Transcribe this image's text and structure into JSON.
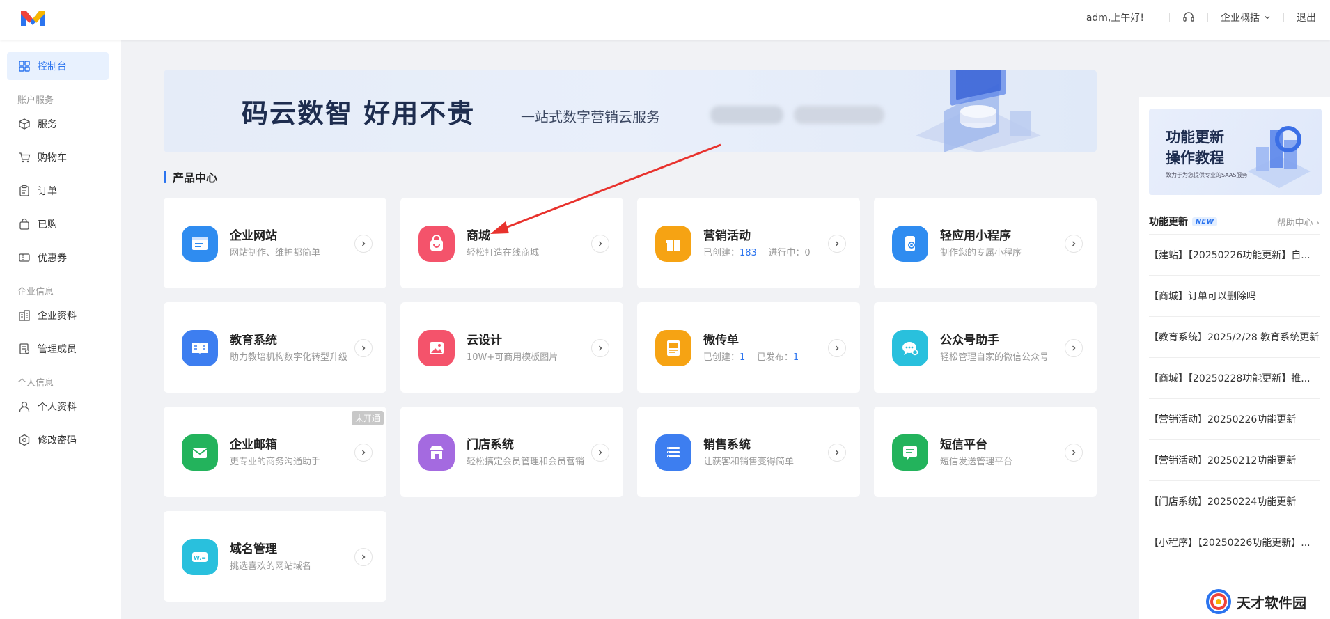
{
  "header": {
    "greeting": "adm,上午好!",
    "enterprise_menu": "企业概括",
    "logout": "退出"
  },
  "sidebar": {
    "items": [
      {
        "label": "控制台",
        "icon": "grid-icon"
      },
      {
        "label": "服务",
        "icon": "box-icon"
      },
      {
        "label": "购物车",
        "icon": "cart-icon"
      },
      {
        "label": "订单",
        "icon": "clipboard-icon"
      },
      {
        "label": "已购",
        "icon": "bag-icon"
      },
      {
        "label": "优惠券",
        "icon": "coupon-icon"
      },
      {
        "label": "企业资料",
        "icon": "building-icon"
      },
      {
        "label": "管理成员",
        "icon": "members-icon"
      },
      {
        "label": "个人资料",
        "icon": "user-icon"
      },
      {
        "label": "修改密码",
        "icon": "hexagon-icon"
      }
    ],
    "groups": [
      "账户服务",
      "企业信息",
      "个人信息"
    ]
  },
  "banner": {
    "title": "码云数智  好用不贵",
    "subtitle": "一站式数字营销云服务"
  },
  "section": {
    "title": "产品中心"
  },
  "products": [
    {
      "name": "企业网站",
      "desc": "网站制作、维护都简单",
      "icon": "website-icon",
      "color": "#2f8cf0"
    },
    {
      "name": "商城",
      "desc": "轻松打造在线商城",
      "icon": "shop-bag-icon",
      "color": "#f4536b"
    },
    {
      "name": "营销活动",
      "desc_prefix": "已创建：",
      "desc_num1": "183",
      "desc_mid": "进行中：",
      "desc_num2": "0",
      "icon": "gift-icon",
      "color": "#f6a313"
    },
    {
      "name": "轻应用小程序",
      "desc": "制作您的专属小程序",
      "icon": "miniapp-icon",
      "color": "#2f8cf0"
    },
    {
      "name": "教育系统",
      "desc": "助力教培机构数字化转型升级",
      "icon": "book-icon",
      "color": "#3d7ef0"
    },
    {
      "name": "云设计",
      "desc": "10W+可商用模板图片",
      "icon": "image-icon",
      "color": "#f4536b"
    },
    {
      "name": "微传单",
      "desc_prefix": "已创建：",
      "desc_num1": "1",
      "desc_mid": "已发布：",
      "desc_num2": "1",
      "icon": "flyer-icon",
      "color": "#f6a313"
    },
    {
      "name": "公众号助手",
      "desc": "轻松管理自家的微信公众号",
      "icon": "chat-icon",
      "color": "#29c0dd"
    },
    {
      "name": "企业邮箱",
      "desc": "更专业的商务沟通助手",
      "icon": "mail-icon",
      "color": "#23b35c",
      "tag": "未开通"
    },
    {
      "name": "门店系统",
      "desc": "轻松搞定会员管理和会员营销",
      "icon": "store-icon",
      "color": "#a46ae0"
    },
    {
      "name": "销售系统",
      "desc": "让获客和销售变得简单",
      "icon": "list-icon",
      "color": "#3d7ef0"
    },
    {
      "name": "短信平台",
      "desc": "短信发送管理平台",
      "icon": "sms-icon",
      "color": "#23b35c"
    },
    {
      "name": "域名管理",
      "desc": "挑选喜欢的网站域名",
      "icon": "domain-icon",
      "color": "#29c0dd",
      "icon_text": "W.="
    }
  ],
  "tutorial": {
    "line1": "功能更新",
    "line2": "操作教程",
    "caption": "致力于为您提供专业的SAAS服务"
  },
  "updates": {
    "title": "功能更新",
    "badge": "NEW",
    "help": "帮助中心",
    "items": [
      "【建站】【20250226功能更新】自...",
      "【商城】订单可以删除吗",
      "【教育系统】2025/2/28 教育系统更新",
      "【商城】【20250228功能更新】推...",
      "【营销活动】20250226功能更新",
      "【营销活动】20250212功能更新",
      "【门店系统】20250224功能更新",
      "【小程序】【20250226功能更新】..."
    ]
  },
  "watermark": {
    "text": "天才软件园"
  }
}
